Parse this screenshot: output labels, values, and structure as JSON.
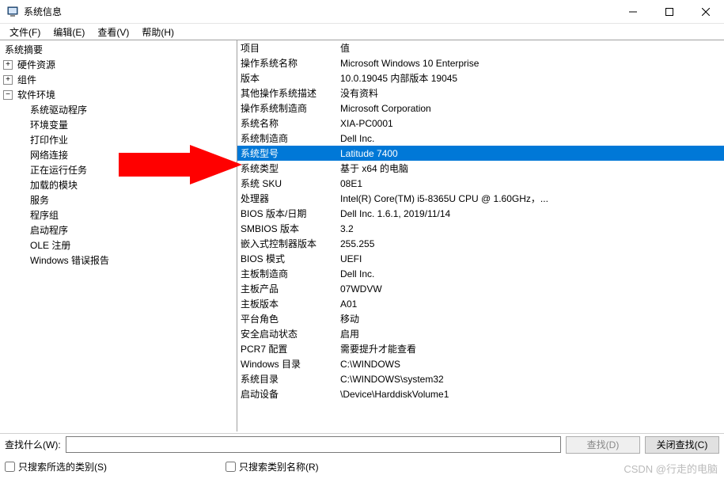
{
  "window": {
    "title": "系统信息"
  },
  "menu": {
    "file": "文件(F)",
    "edit": "编辑(E)",
    "view": "查看(V)",
    "help": "帮助(H)"
  },
  "tree": {
    "summary": "系统摘要",
    "hardware": "硬件资源",
    "components": "组件",
    "software_env": "软件环境",
    "items": {
      "sys_drivers": "系统驱动程序",
      "env_vars": "环境变量",
      "print_jobs": "打印作业",
      "net_conn": "网络连接",
      "running_tasks": "正在运行任务",
      "loaded_modules": "加载的模块",
      "services": "服务",
      "program_groups": "程序组",
      "startup_programs": "启动程序",
      "ole_reg": "OLE 注册",
      "win_err_report": "Windows 错误报告"
    }
  },
  "details": {
    "header_item": "项目",
    "header_value": "值",
    "rows": [
      {
        "name": "操作系统名称",
        "value": "Microsoft Windows 10 Enterprise"
      },
      {
        "name": "版本",
        "value": "10.0.19045 内部版本 19045"
      },
      {
        "name": "其他操作系统描述",
        "value": "没有资料"
      },
      {
        "name": "操作系统制造商",
        "value": "Microsoft Corporation"
      },
      {
        "name": "系统名称",
        "value": "XIA-PC0001"
      },
      {
        "name": "系统制造商",
        "value": "Dell Inc."
      },
      {
        "name": "系统型号",
        "value": "Latitude 7400"
      },
      {
        "name": "系统类型",
        "value": "基于 x64 的电脑"
      },
      {
        "name": "系统 SKU",
        "value": "08E1"
      },
      {
        "name": "处理器",
        "value": "Intel(R) Core(TM) i5-8365U CPU @ 1.60GHz，..."
      },
      {
        "name": "BIOS 版本/日期",
        "value": "Dell Inc. 1.6.1, 2019/11/14"
      },
      {
        "name": "SMBIOS 版本",
        "value": "3.2"
      },
      {
        "name": "嵌入式控制器版本",
        "value": "255.255"
      },
      {
        "name": "BIOS 模式",
        "value": "UEFI"
      },
      {
        "name": "主板制造商",
        "value": "Dell Inc."
      },
      {
        "name": "主板产品",
        "value": "07WDVW"
      },
      {
        "name": "主板版本",
        "value": "A01"
      },
      {
        "name": "平台角色",
        "value": "移动"
      },
      {
        "name": "安全启动状态",
        "value": "启用"
      },
      {
        "name": "PCR7 配置",
        "value": "需要提升才能查看"
      },
      {
        "name": "Windows 目录",
        "value": "C:\\WINDOWS"
      },
      {
        "name": "系统目录",
        "value": "C:\\WINDOWS\\system32"
      },
      {
        "name": "启动设备",
        "value": "\\Device\\HarddiskVolume1"
      }
    ],
    "selected_index": 6
  },
  "search": {
    "label": "查找什么(W):",
    "value": "",
    "find_btn": "查找(D)",
    "close_find_btn": "关闭查找(C)",
    "cb_selected_only": "只搜索所选的类别(S)",
    "cb_names_only": "只搜索类别名称(R)"
  },
  "watermark": "CSDN @行走的电脑"
}
